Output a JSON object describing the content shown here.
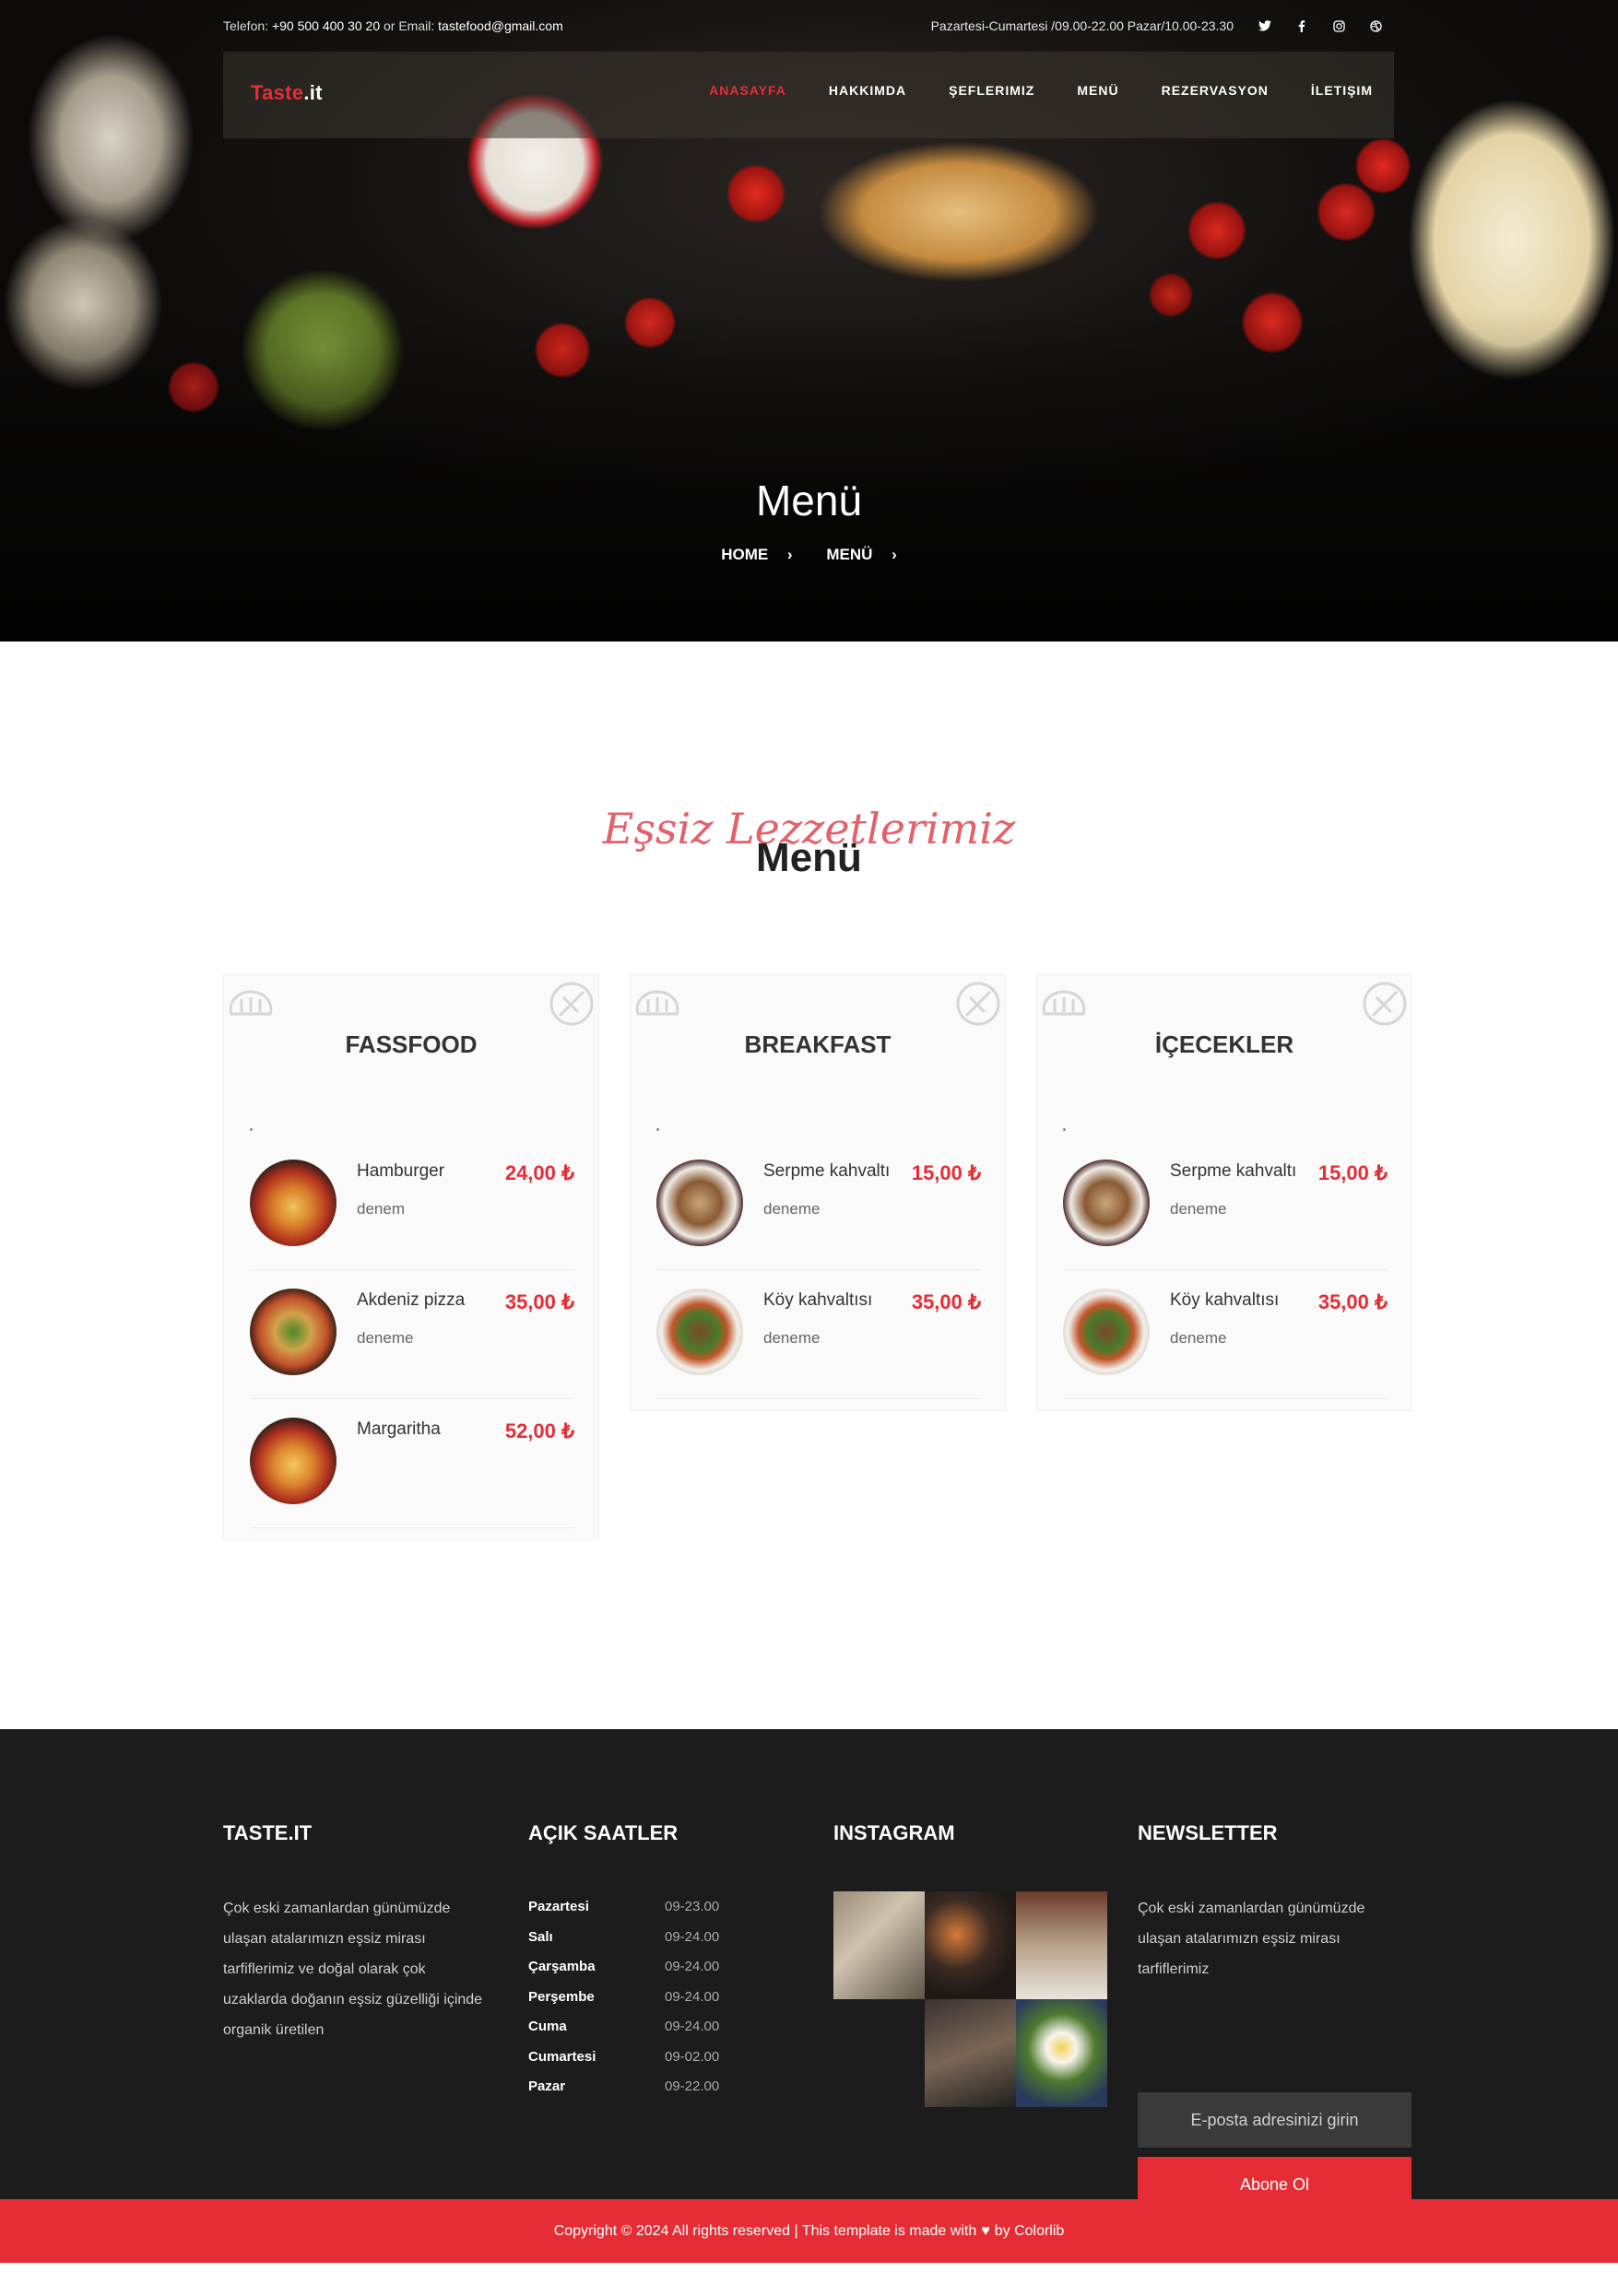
{
  "topbar": {
    "phone_label": "Telefon:",
    "phone": "+90 500 400 30 20",
    "or_label": "or",
    "email_label": "Email:",
    "email": "tastefood@gmail.com",
    "hours": "Pazartesi-Cumartesi /09.00-22.00 Pazar/10.00-23.30",
    "social": [
      "twitter-icon",
      "facebook-icon",
      "instagram-icon",
      "dribbble-icon"
    ]
  },
  "brand": {
    "part1": "Taste",
    "part2": ".it"
  },
  "nav": [
    {
      "label": "ANASAYFA",
      "active": true
    },
    {
      "label": "HAKKIMDA"
    },
    {
      "label": "ŞEFLERIMIZ"
    },
    {
      "label": "MENÜ"
    },
    {
      "label": "REZERVASYON"
    },
    {
      "label": "İLETIŞIM"
    }
  ],
  "hero": {
    "title": "Menü",
    "breadcrumb": [
      "HOME",
      "MENÜ"
    ]
  },
  "section": {
    "subtitle": "Eşsiz Lezzetlerimiz",
    "title": "Menü"
  },
  "menus": [
    {
      "title": "FASSFOOD",
      "items": [
        {
          "name": "Hamburger",
          "desc": "denem",
          "price": "24,00 ₺"
        },
        {
          "name": "Akdeniz pizza",
          "desc": "deneme",
          "price": "35,00 ₺"
        },
        {
          "name": "Margaritha",
          "desc": "",
          "price": "52,00 ₺"
        }
      ]
    },
    {
      "title": "BREAKFAST",
      "items": [
        {
          "name": "Serpme kahvaltı",
          "desc": "deneme",
          "price": "15,00 ₺"
        },
        {
          "name": "Köy kahvaltısı",
          "desc": "deneme",
          "price": "35,00 ₺"
        }
      ]
    },
    {
      "title": "İÇECEKLER",
      "items": [
        {
          "name": "Serpme kahvaltı",
          "desc": "deneme",
          "price": "15,00 ₺"
        },
        {
          "name": "Köy kahvaltısı",
          "desc": "deneme",
          "price": "35,00 ₺"
        }
      ]
    }
  ],
  "footer": {
    "about": {
      "title": "TASTE.IT",
      "text": "Çok eski zamanlardan günümüzde ulaşan atalarımızn eşsiz mirası tarfiflerimiz ve doğal olarak çok uzaklarda doğanın eşsiz güzelliği içinde organik üretilen"
    },
    "hours": {
      "title": "AÇIK SAATLER",
      "rows": [
        {
          "day": "Pazartesi",
          "time": "09-23.00"
        },
        {
          "day": "Salı",
          "time": "09-24.00"
        },
        {
          "day": "Çarşamba",
          "time": "09-24.00"
        },
        {
          "day": "Perşembe",
          "time": "09-24.00"
        },
        {
          "day": "Cuma",
          "time": "09-24.00"
        },
        {
          "day": "Cumartesi",
          "time": "09-02.00"
        },
        {
          "day": "Pazar",
          "time": "09-22.00"
        }
      ]
    },
    "instagram": {
      "title": "INSTAGRAM"
    },
    "newsletter": {
      "title": "NEWSLETTER",
      "text": "Çok eski zamanlardan günümüzde ulaşan atalarımızn eşsiz mirası tarfiflerimiz",
      "placeholder": "E-posta adresinizi girin",
      "button": "Abone Ol"
    }
  },
  "copyright": {
    "before": "Copyright © 2024 All rights reserved | This template is made with",
    "after": "by Colorlib"
  },
  "colors": {
    "accent": "#e62d36",
    "footer_bg": "#1c1c1c"
  }
}
